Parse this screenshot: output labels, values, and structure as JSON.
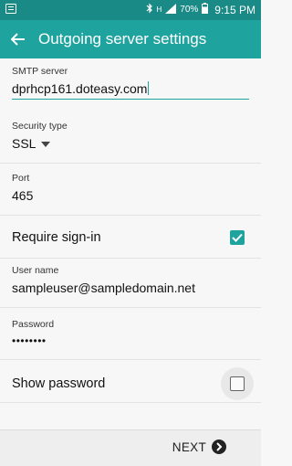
{
  "status_bar": {
    "battery": "70%",
    "time": "9:15 PM",
    "network": "H"
  },
  "app_bar": {
    "title": "Outgoing server settings"
  },
  "form": {
    "smtp_label": "SMTP server",
    "smtp_value": "dprhcp161.doteasy.com",
    "security_label": "Security type",
    "security_value": "SSL",
    "port_label": "Port",
    "port_value": "465",
    "require_signin_label": "Require sign-in",
    "require_signin_checked": true,
    "username_label": "User name",
    "username_value": "sampleuser@sampledomain.net",
    "password_label": "Password",
    "password_value": "••••••••",
    "show_password_label": "Show password",
    "show_password_checked": false
  },
  "footer": {
    "next_label": "NEXT"
  },
  "colors": {
    "accent": "#1fa39f",
    "statusbar": "#1a8a87"
  }
}
